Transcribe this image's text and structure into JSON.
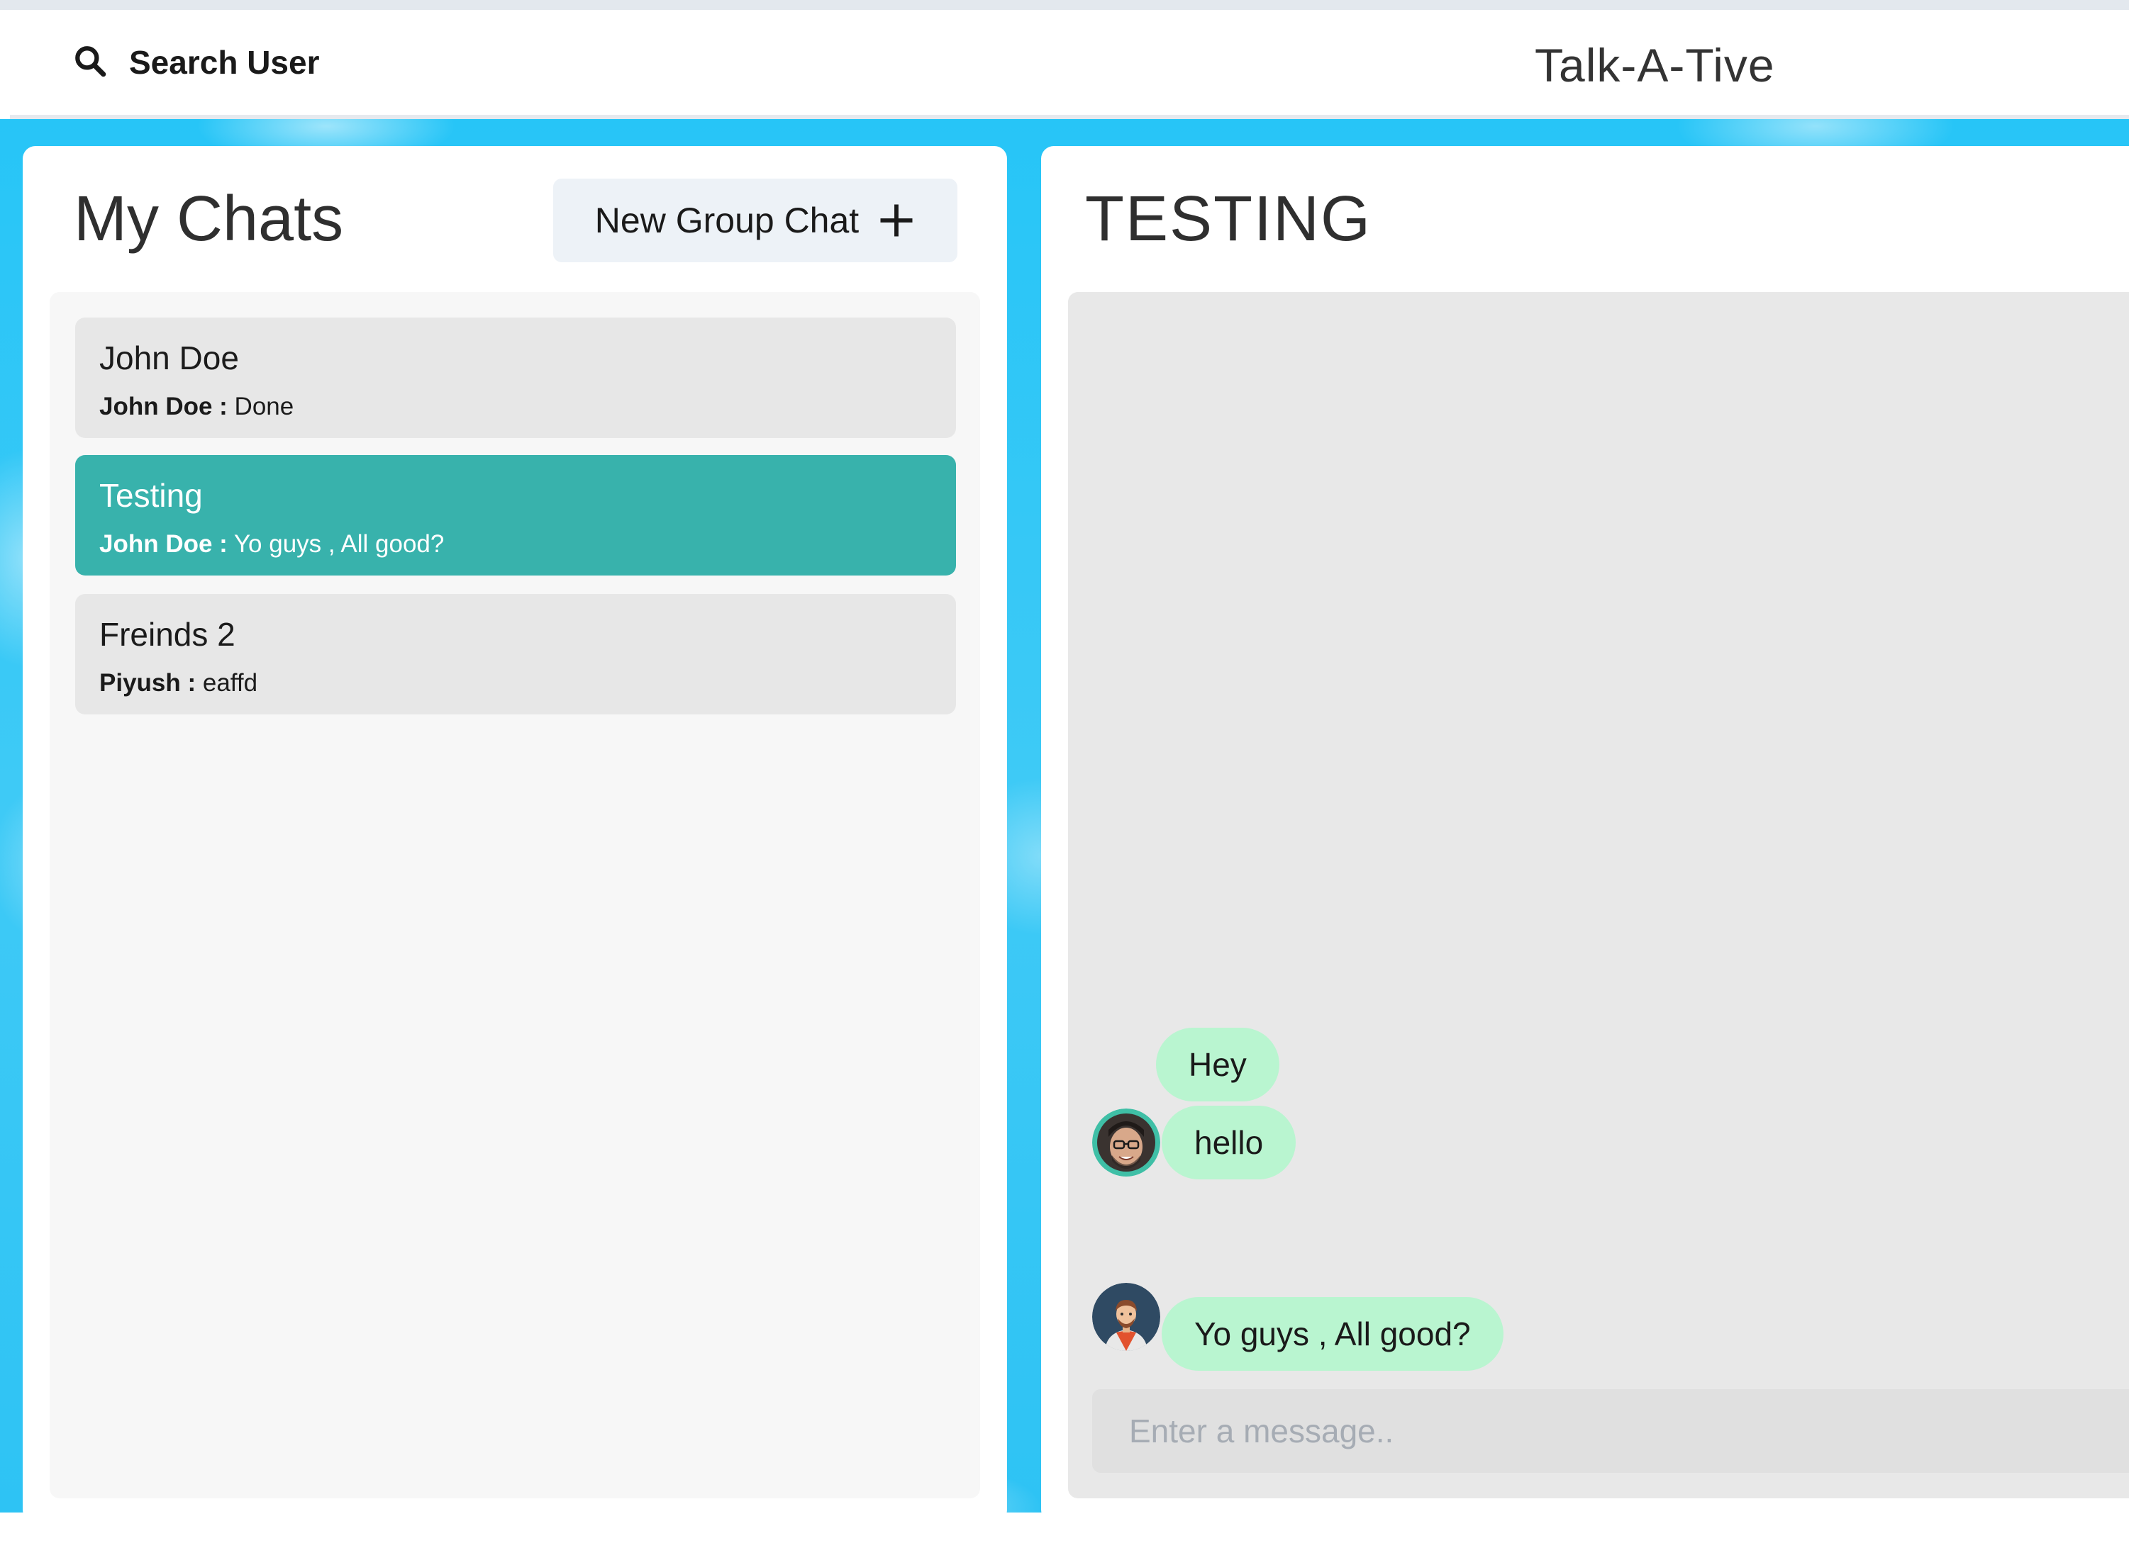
{
  "header": {
    "search_label": "Search User",
    "app_title": "Talk-A-Tive",
    "search_icon": "magnifying-glass"
  },
  "sidebar": {
    "title": "My Chats",
    "new_group_label": "New Group Chat",
    "new_group_icon": "plus",
    "chats": [
      {
        "name": "John Doe",
        "last_sender": "John Doe :",
        "last_message": " Done",
        "active": false
      },
      {
        "name": "Testing",
        "last_sender": "John Doe :",
        "last_message": " Yo guys , All good?",
        "active": true
      },
      {
        "name": "Freinds 2",
        "last_sender": "Piyush :",
        "last_message": " eaffd",
        "active": false
      }
    ]
  },
  "chat": {
    "title": "TESTING",
    "messages": [
      {
        "text": "Hey"
      },
      {
        "text": "hello",
        "avatar": "avatar-man-glasses"
      },
      {
        "text": "Yo guys , All good?",
        "avatar": "avatar-man-cartoon"
      }
    ],
    "input_placeholder": "Enter a message.."
  },
  "colors": {
    "active_chat": "#38b2ac",
    "bubble": "#b9f5d0",
    "background": "#27c5f7"
  }
}
